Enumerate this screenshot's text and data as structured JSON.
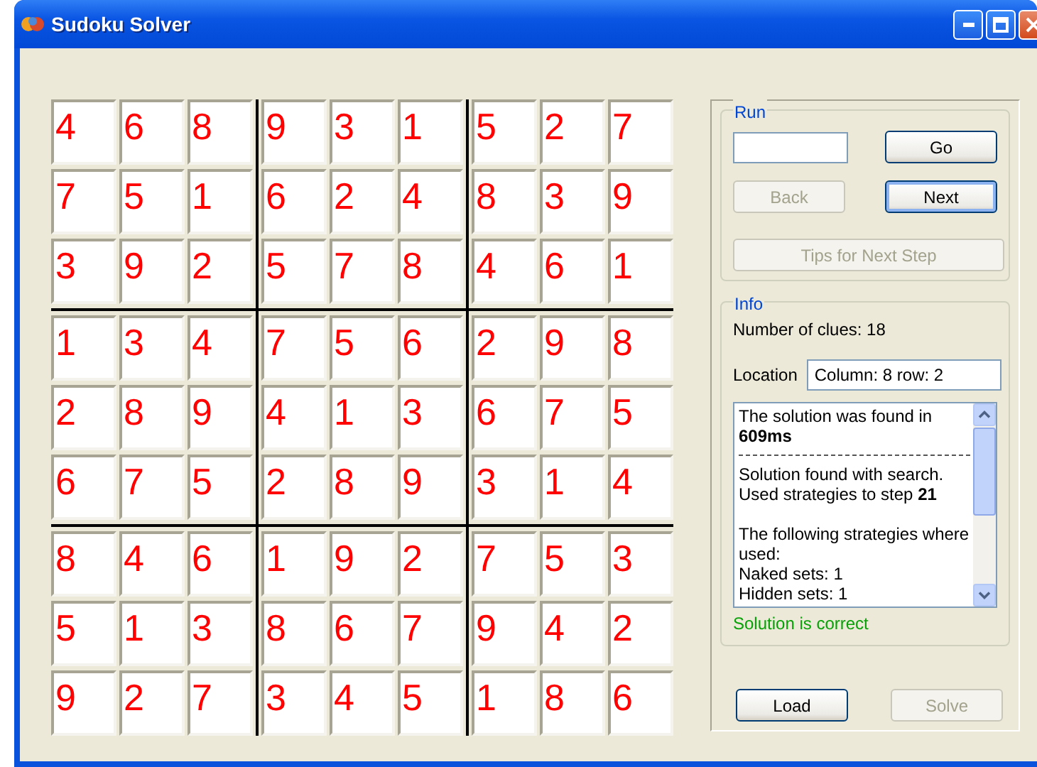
{
  "window": {
    "title": "Sudoku Solver"
  },
  "grid": [
    [
      "4",
      "6",
      "8",
      "9",
      "3",
      "1",
      "5",
      "2",
      "7"
    ],
    [
      "7",
      "5",
      "1",
      "6",
      "2",
      "4",
      "8",
      "3",
      "9"
    ],
    [
      "3",
      "9",
      "2",
      "5",
      "7",
      "8",
      "4",
      "6",
      "1"
    ],
    [
      "1",
      "3",
      "4",
      "7",
      "5",
      "6",
      "2",
      "9",
      "8"
    ],
    [
      "2",
      "8",
      "9",
      "4",
      "1",
      "3",
      "6",
      "7",
      "5"
    ],
    [
      "6",
      "7",
      "5",
      "2",
      "8",
      "9",
      "3",
      "1",
      "4"
    ],
    [
      "8",
      "4",
      "6",
      "1",
      "9",
      "2",
      "7",
      "5",
      "3"
    ],
    [
      "5",
      "1",
      "3",
      "8",
      "6",
      "7",
      "9",
      "4",
      "2"
    ],
    [
      "9",
      "2",
      "7",
      "3",
      "4",
      "5",
      "1",
      "8",
      "6"
    ]
  ],
  "run": {
    "title": "Run",
    "buttons": [
      {
        "label": "Go",
        "disabled": false,
        "focused": false
      },
      {
        "label": "Back",
        "disabled": true,
        "focused": false
      },
      {
        "label": "Next",
        "disabled": false,
        "focused": true
      }
    ],
    "tips_button": {
      "label": "Tips for Next Step",
      "disabled": true
    }
  },
  "info": {
    "title": "Info",
    "clues": "Number of clues: 18",
    "location_label": "Location",
    "location_value": "Column: 8 row: 2",
    "log": [
      {
        "kind": "text",
        "text": "The solution was found in **609ms**"
      },
      {
        "kind": "rule"
      },
      {
        "kind": "text",
        "text": "Solution found with search. Used strategies to step **21**"
      },
      {
        "kind": "gap"
      },
      {
        "kind": "text",
        "text": "The following strategies where used:"
      },
      {
        "kind": "text",
        "text": "Naked sets: 1"
      },
      {
        "kind": "text",
        "text": "Hidden sets: 1"
      }
    ],
    "status": "Solution is correct"
  },
  "bottom_buttons": [
    {
      "label": "Load",
      "disabled": false
    },
    {
      "label": "Solve",
      "disabled": true
    }
  ]
}
